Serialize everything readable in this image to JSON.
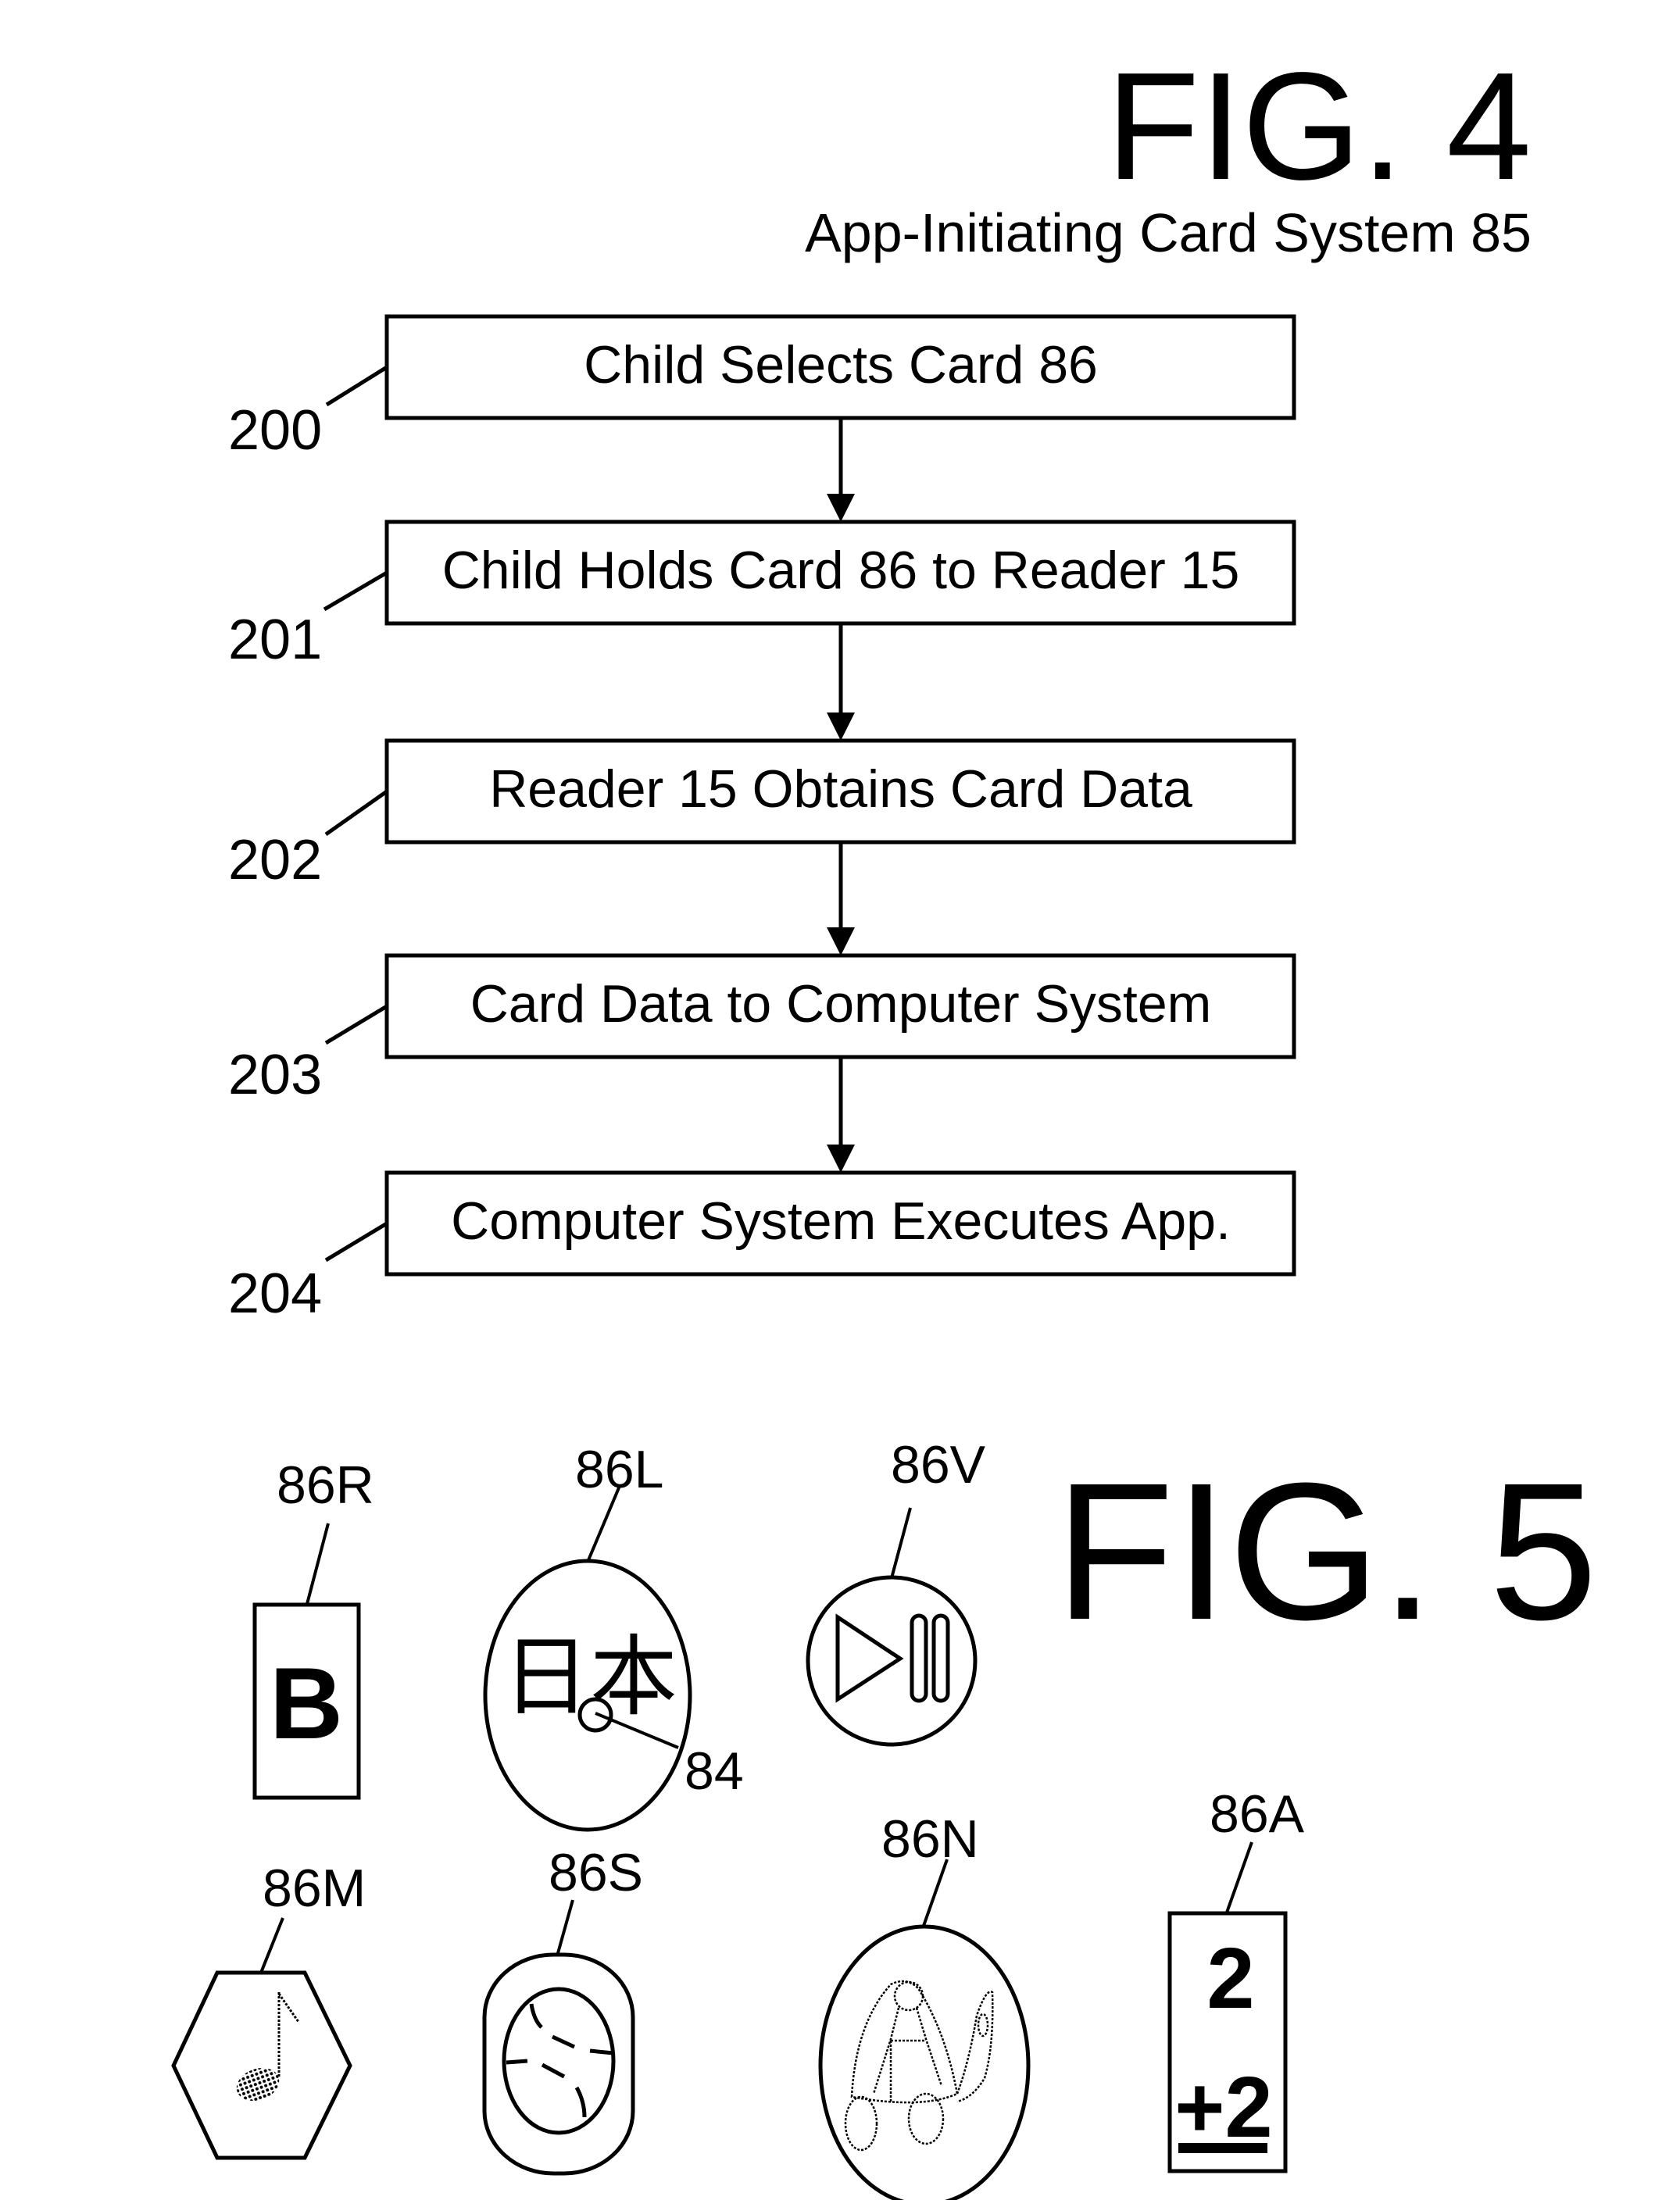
{
  "fig4": {
    "title": "FIG. 4",
    "subtitle": "App-Initiating Card System 85",
    "steps": [
      {
        "ref": "200",
        "label": "Child Selects Card 86"
      },
      {
        "ref": "201",
        "label": "Child Holds Card 86 to Reader 15"
      },
      {
        "ref": "202",
        "label": "Reader 15 Obtains Card Data"
      },
      {
        "ref": "203",
        "label": "Card Data to Computer System"
      },
      {
        "ref": "204",
        "label": "Computer System Executes App."
      }
    ]
  },
  "fig5": {
    "title": "FIG. 5",
    "cards": {
      "reading": {
        "ref": "86R",
        "symbol": "B",
        "icon": "letter-b-card"
      },
      "language": {
        "ref": "86L",
        "symbol": "日本",
        "icon": "kanji-nihon-card",
        "marker_ref": "84"
      },
      "video": {
        "ref": "86V",
        "icon": "play-pause-card"
      },
      "music": {
        "ref": "86M",
        "icon": "music-note-card"
      },
      "sports": {
        "ref": "86S",
        "icon": "baseball-card"
      },
      "nature": {
        "ref": "86N",
        "icon": "turtle-card"
      },
      "arithmetic": {
        "ref": "86A",
        "top": "2",
        "bottom": "+2",
        "icon": "addition-card"
      }
    }
  }
}
